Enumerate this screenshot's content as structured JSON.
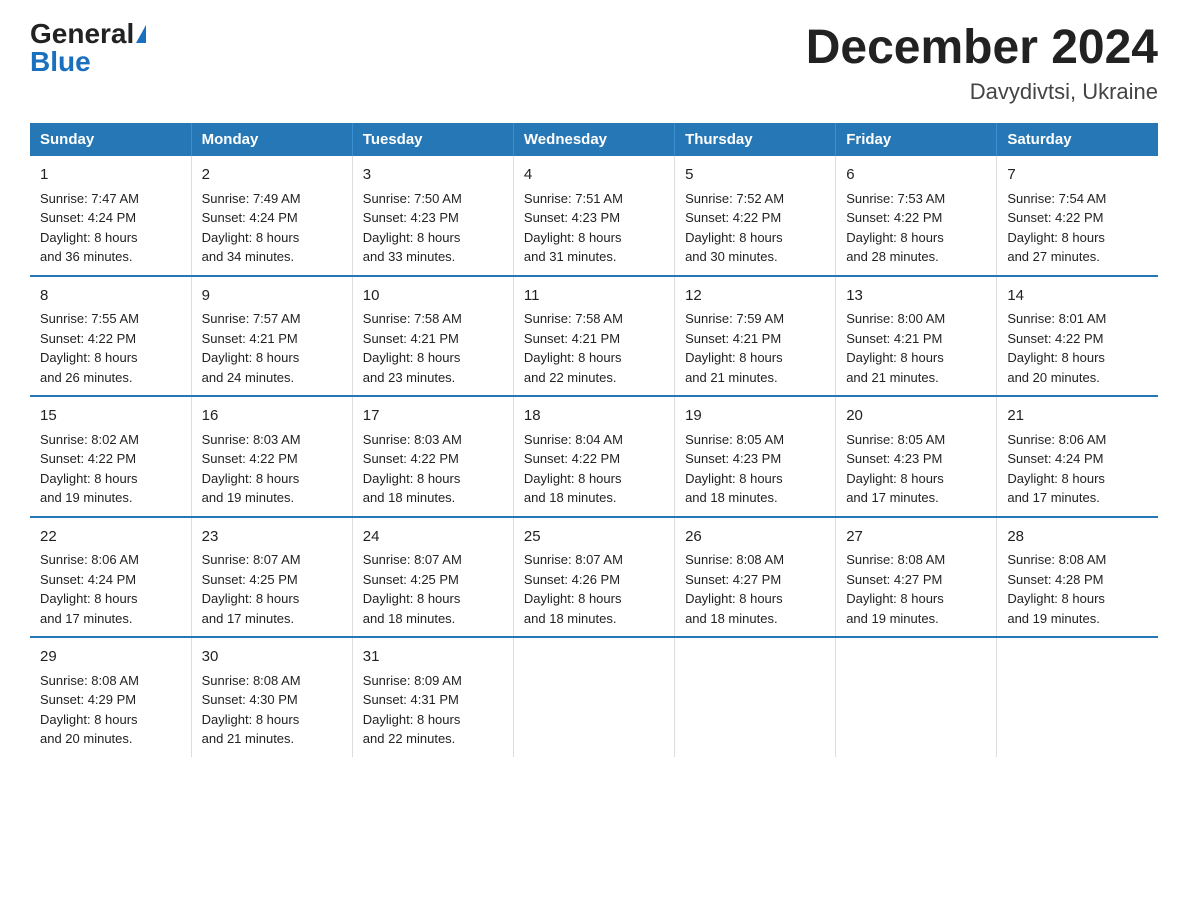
{
  "header": {
    "logo_general": "General",
    "logo_blue": "Blue",
    "title": "December 2024",
    "subtitle": "Davydivtsi, Ukraine"
  },
  "days_of_week": [
    "Sunday",
    "Monday",
    "Tuesday",
    "Wednesday",
    "Thursday",
    "Friday",
    "Saturday"
  ],
  "weeks": [
    [
      {
        "day": "1",
        "sunrise": "7:47 AM",
        "sunset": "4:24 PM",
        "daylight": "8 hours and 36 minutes."
      },
      {
        "day": "2",
        "sunrise": "7:49 AM",
        "sunset": "4:24 PM",
        "daylight": "8 hours and 34 minutes."
      },
      {
        "day": "3",
        "sunrise": "7:50 AM",
        "sunset": "4:23 PM",
        "daylight": "8 hours and 33 minutes."
      },
      {
        "day": "4",
        "sunrise": "7:51 AM",
        "sunset": "4:23 PM",
        "daylight": "8 hours and 31 minutes."
      },
      {
        "day": "5",
        "sunrise": "7:52 AM",
        "sunset": "4:22 PM",
        "daylight": "8 hours and 30 minutes."
      },
      {
        "day": "6",
        "sunrise": "7:53 AM",
        "sunset": "4:22 PM",
        "daylight": "8 hours and 28 minutes."
      },
      {
        "day": "7",
        "sunrise": "7:54 AM",
        "sunset": "4:22 PM",
        "daylight": "8 hours and 27 minutes."
      }
    ],
    [
      {
        "day": "8",
        "sunrise": "7:55 AM",
        "sunset": "4:22 PM",
        "daylight": "8 hours and 26 minutes."
      },
      {
        "day": "9",
        "sunrise": "7:57 AM",
        "sunset": "4:21 PM",
        "daylight": "8 hours and 24 minutes."
      },
      {
        "day": "10",
        "sunrise": "7:58 AM",
        "sunset": "4:21 PM",
        "daylight": "8 hours and 23 minutes."
      },
      {
        "day": "11",
        "sunrise": "7:58 AM",
        "sunset": "4:21 PM",
        "daylight": "8 hours and 22 minutes."
      },
      {
        "day": "12",
        "sunrise": "7:59 AM",
        "sunset": "4:21 PM",
        "daylight": "8 hours and 21 minutes."
      },
      {
        "day": "13",
        "sunrise": "8:00 AM",
        "sunset": "4:21 PM",
        "daylight": "8 hours and 21 minutes."
      },
      {
        "day": "14",
        "sunrise": "8:01 AM",
        "sunset": "4:22 PM",
        "daylight": "8 hours and 20 minutes."
      }
    ],
    [
      {
        "day": "15",
        "sunrise": "8:02 AM",
        "sunset": "4:22 PM",
        "daylight": "8 hours and 19 minutes."
      },
      {
        "day": "16",
        "sunrise": "8:03 AM",
        "sunset": "4:22 PM",
        "daylight": "8 hours and 19 minutes."
      },
      {
        "day": "17",
        "sunrise": "8:03 AM",
        "sunset": "4:22 PM",
        "daylight": "8 hours and 18 minutes."
      },
      {
        "day": "18",
        "sunrise": "8:04 AM",
        "sunset": "4:22 PM",
        "daylight": "8 hours and 18 minutes."
      },
      {
        "day": "19",
        "sunrise": "8:05 AM",
        "sunset": "4:23 PM",
        "daylight": "8 hours and 18 minutes."
      },
      {
        "day": "20",
        "sunrise": "8:05 AM",
        "sunset": "4:23 PM",
        "daylight": "8 hours and 17 minutes."
      },
      {
        "day": "21",
        "sunrise": "8:06 AM",
        "sunset": "4:24 PM",
        "daylight": "8 hours and 17 minutes."
      }
    ],
    [
      {
        "day": "22",
        "sunrise": "8:06 AM",
        "sunset": "4:24 PM",
        "daylight": "8 hours and 17 minutes."
      },
      {
        "day": "23",
        "sunrise": "8:07 AM",
        "sunset": "4:25 PM",
        "daylight": "8 hours and 17 minutes."
      },
      {
        "day": "24",
        "sunrise": "8:07 AM",
        "sunset": "4:25 PM",
        "daylight": "8 hours and 18 minutes."
      },
      {
        "day": "25",
        "sunrise": "8:07 AM",
        "sunset": "4:26 PM",
        "daylight": "8 hours and 18 minutes."
      },
      {
        "day": "26",
        "sunrise": "8:08 AM",
        "sunset": "4:27 PM",
        "daylight": "8 hours and 18 minutes."
      },
      {
        "day": "27",
        "sunrise": "8:08 AM",
        "sunset": "4:27 PM",
        "daylight": "8 hours and 19 minutes."
      },
      {
        "day": "28",
        "sunrise": "8:08 AM",
        "sunset": "4:28 PM",
        "daylight": "8 hours and 19 minutes."
      }
    ],
    [
      {
        "day": "29",
        "sunrise": "8:08 AM",
        "sunset": "4:29 PM",
        "daylight": "8 hours and 20 minutes."
      },
      {
        "day": "30",
        "sunrise": "8:08 AM",
        "sunset": "4:30 PM",
        "daylight": "8 hours and 21 minutes."
      },
      {
        "day": "31",
        "sunrise": "8:09 AM",
        "sunset": "4:31 PM",
        "daylight": "8 hours and 22 minutes."
      },
      null,
      null,
      null,
      null
    ]
  ],
  "labels": {
    "sunrise": "Sunrise:",
    "sunset": "Sunset:",
    "daylight": "Daylight:"
  }
}
